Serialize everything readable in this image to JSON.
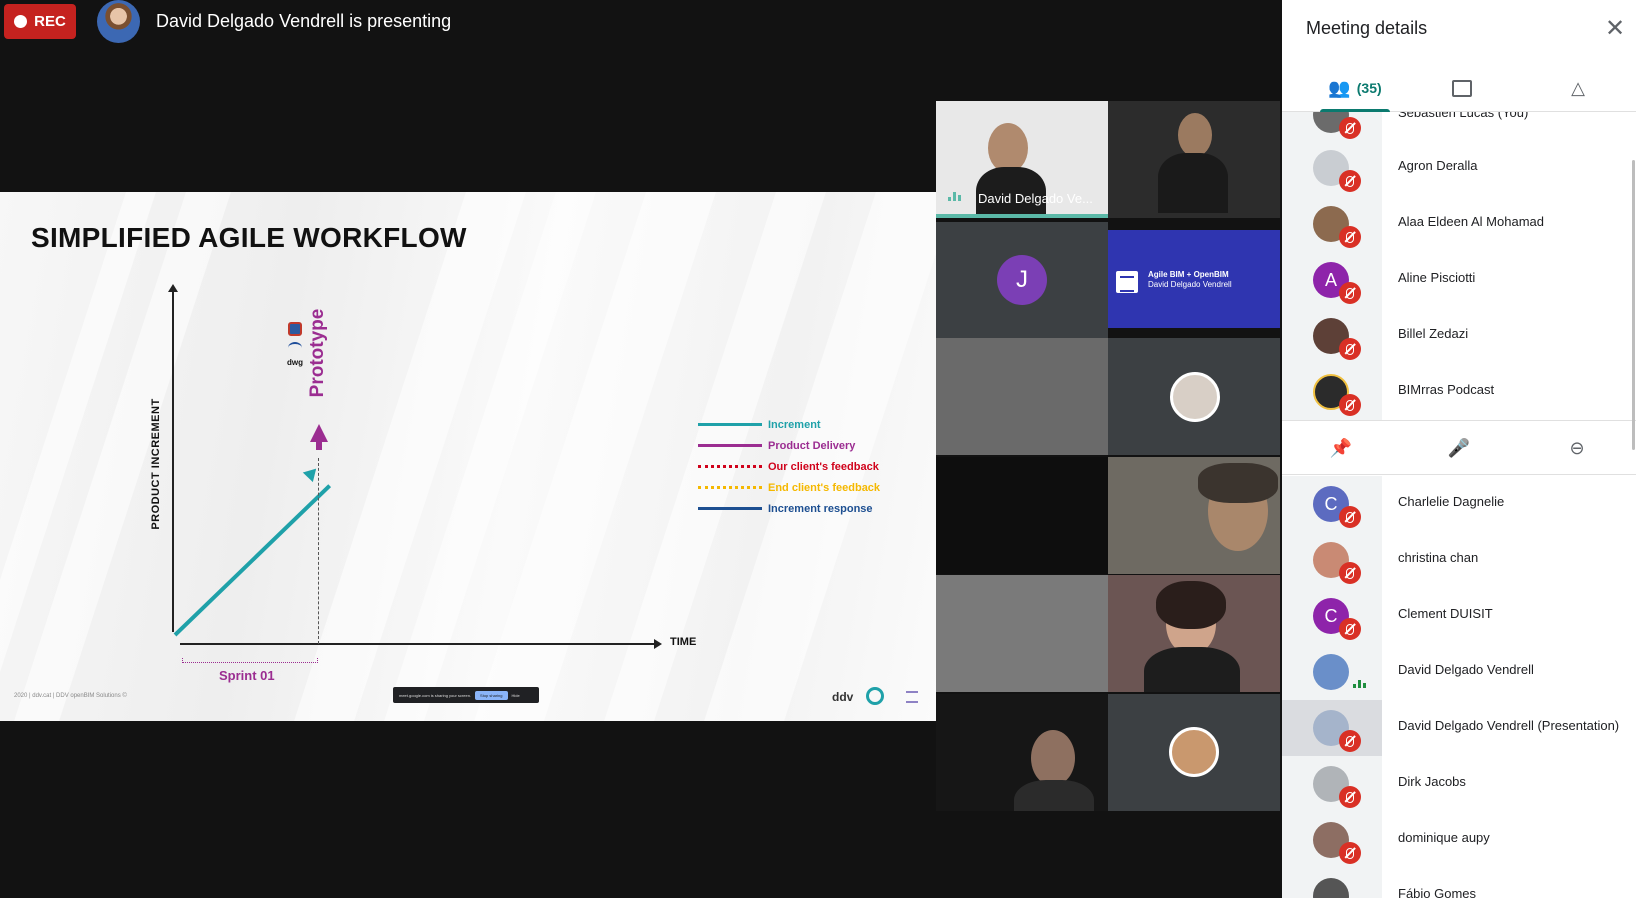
{
  "top_bar": {
    "rec_label": "REC",
    "presenting_text": "David Delgado Vendrell is presenting"
  },
  "slide": {
    "title": "SIMPLIFIED AGILE WORKFLOW",
    "y_axis_label": "PRODUCT INCREMENT",
    "x_axis_label": "TIME",
    "sprint_label": "Sprint 01",
    "prototype_label": "Prototype",
    "mini_icon_label": "dwg",
    "legend": [
      {
        "label": "Increment",
        "color": "#1fa1a9",
        "style": "solid"
      },
      {
        "label": "Product Delivery",
        "color": "#9b2d91",
        "style": "solid"
      },
      {
        "label": "Our client's feedback",
        "color": "#d0021b",
        "style": "dotted"
      },
      {
        "label": "End client's feedback",
        "color": "#f5b800",
        "style": "dotted"
      },
      {
        "label": "Increment response",
        "color": "#1d4f91",
        "style": "solid"
      }
    ],
    "footer": "2020 | ddv.cat | DDV openBIM Solutions ©",
    "share_bar_text": "meet.google.com is sharing your screen.",
    "share_bar_stop": "Stop sharing",
    "share_bar_hide": "Hide",
    "logo_text": "ddv"
  },
  "tiles": {
    "speaker_name": "David Delgado Ve...",
    "letter_avatar": "J",
    "presentation_line1": "Agile BIM + OpenBIM",
    "presentation_line2": "David Delgado Vendrell"
  },
  "panel": {
    "title": "Meeting details",
    "people_count": "(35)",
    "participants_top": [
      {
        "name": "Sebastien Lucas (You)",
        "avatar": "photo",
        "color": "#6b6b6b"
      },
      {
        "name": "Agron Deralla",
        "avatar": "photo",
        "color": "#c9cdd2"
      },
      {
        "name": "Alaa Eldeen Al Mohamad",
        "avatar": "photo",
        "color": "#8c6a4f"
      },
      {
        "name": "Aline Pisciotti",
        "avatar": "A",
        "color": "#8e24aa"
      },
      {
        "name": "Billel Zedazi",
        "avatar": "photo",
        "color": "#5d4037"
      },
      {
        "name": "BIMrras Podcast",
        "avatar": "photo",
        "color": "#2b2b2b"
      }
    ],
    "participants_bottom": [
      {
        "name": "Charlelie Dagnelie",
        "avatar": "C",
        "color": "#5c6bc0"
      },
      {
        "name": "christina chan",
        "avatar": "photo",
        "color": "#c98a74"
      },
      {
        "name": "Clement DUISIT",
        "avatar": "C",
        "color": "#8e24aa"
      },
      {
        "name": "David Delgado Vendrell",
        "avatar": "photo",
        "color": "#6a8fc9"
      },
      {
        "name": "David Delgado Vendrell (Presentation)",
        "avatar": "photo",
        "color": "#8fa3c2"
      },
      {
        "name": "Dirk Jacobs",
        "avatar": "photo",
        "color": "#b0b4b8"
      },
      {
        "name": "dominique aupy",
        "avatar": "photo",
        "color": "#8d6e63"
      },
      {
        "name": "Fábio Gomes",
        "avatar": "photo",
        "color": "#555555"
      }
    ]
  }
}
